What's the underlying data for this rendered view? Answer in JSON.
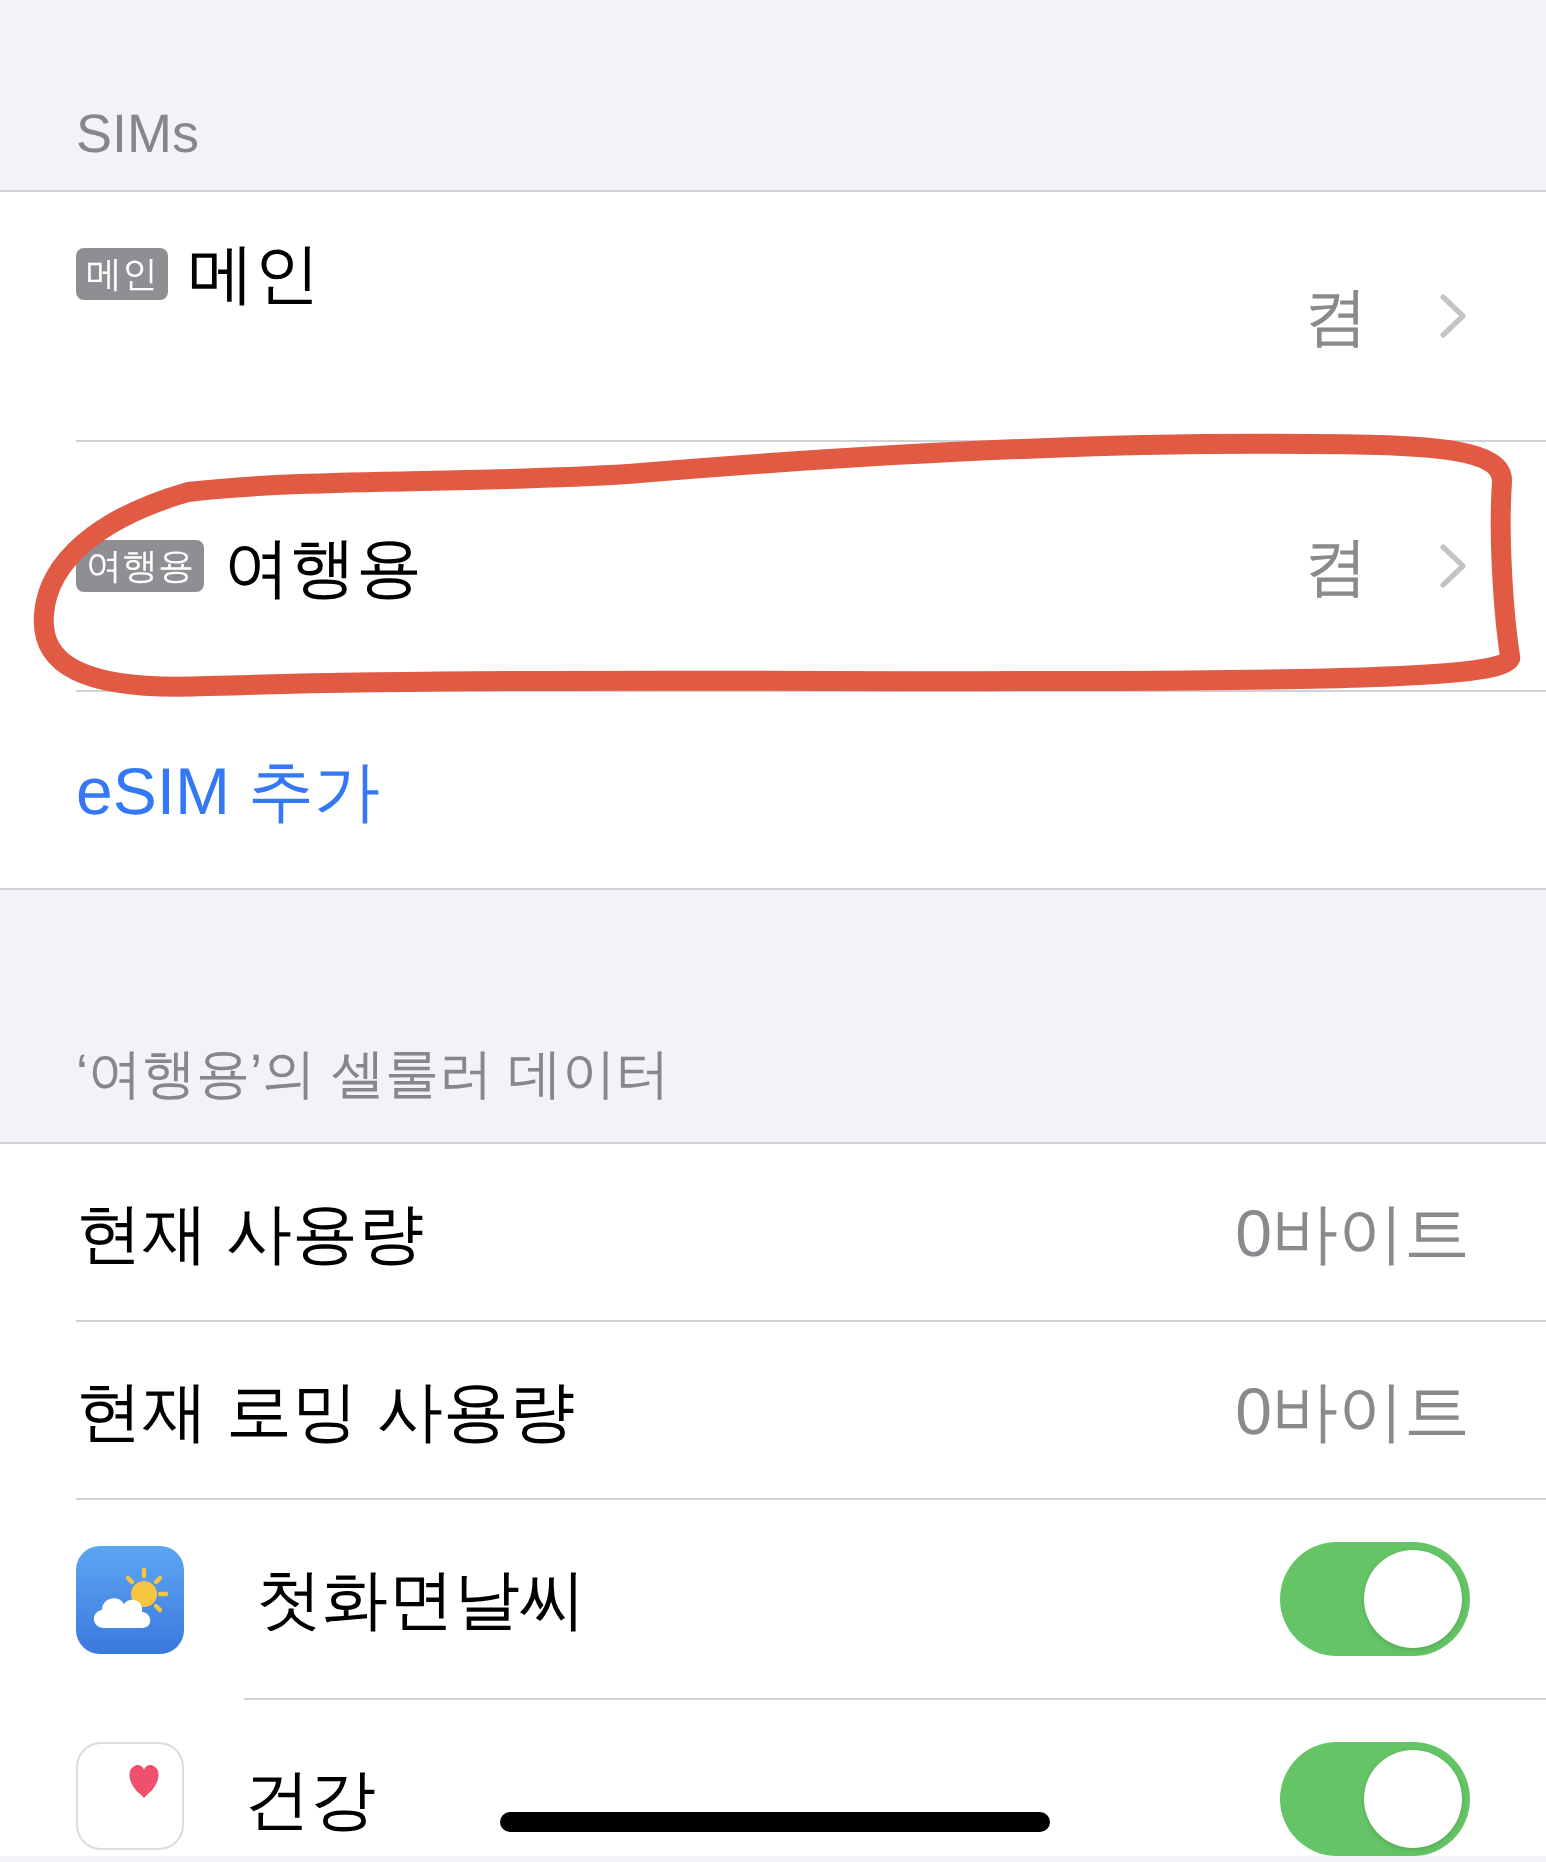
{
  "sims_section": {
    "header": "SIMs",
    "sims": [
      {
        "badge": "메인",
        "name": "메인",
        "status": "켬",
        "circled": false
      },
      {
        "badge": "여행용",
        "name": "여행용",
        "status": "켬",
        "circled": true
      }
    ],
    "add_link": "eSIM 추가"
  },
  "cellular_section": {
    "header": "‘여행용’의 셀룰러 데이터",
    "usage_rows": [
      {
        "label": "현재 사용량",
        "value": "0바이트"
      },
      {
        "label": "현재 로밍 사용량",
        "value": "0바이트"
      }
    ],
    "apps": [
      {
        "kind": "weather",
        "name": "첫화면날씨",
        "on": true
      },
      {
        "kind": "health",
        "name": "건강",
        "on": true
      }
    ]
  }
}
